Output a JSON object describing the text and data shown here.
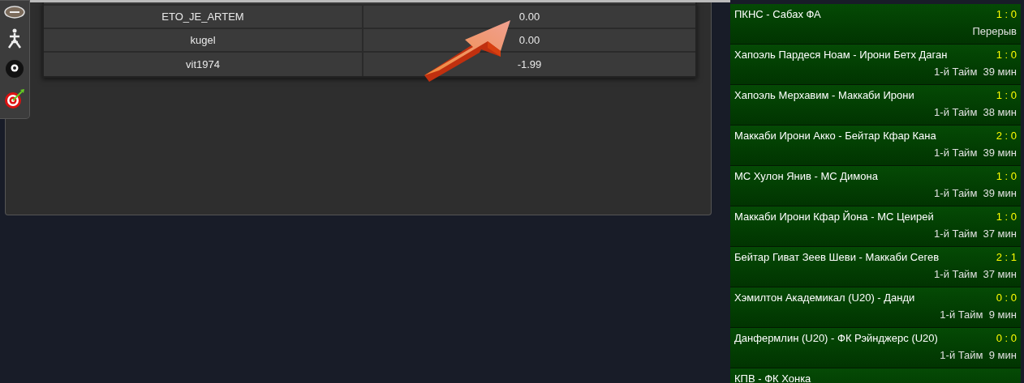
{
  "results_table": {
    "rows": [
      {
        "player": "ETO_JE_ARTEM",
        "amount": "0.00"
      },
      {
        "player": "kugel",
        "amount": "0.00"
      },
      {
        "player": "vit1974",
        "amount": "-1.99"
      }
    ]
  },
  "live_matches": [
    {
      "teams": "ПКНС - Сабах ФА",
      "score": "1 : 0",
      "status": "Перерыв"
    },
    {
      "teams": "Хапоэль Пардеся Ноам - Ирони Бетх Даган",
      "score": "1 : 0",
      "status": "1-й Тайм  39 мин"
    },
    {
      "teams": "Хапоэль Мерхавим - Маккаби Ирони",
      "score": "1 : 0",
      "status": "1-й Тайм  38 мин"
    },
    {
      "teams": "Маккаби Ирони Акко - Бейтар Кфар Кана",
      "score": "2 : 0",
      "status": "1-й Тайм  39 мин"
    },
    {
      "teams": "МС Хулон Янив - МС Димона",
      "score": "1 : 0",
      "status": "1-й Тайм  39 мин"
    },
    {
      "teams": "Маккаби Ирони Кфар Йона - МС Цеирей",
      "score": "1 : 0",
      "status": "1-й Тайм  37 мин"
    },
    {
      "teams": "Бейтар Гиват Зеев Шеви - Маккаби Сегев",
      "score": "2 : 1",
      "status": "1-й Тайм  37 мин"
    },
    {
      "teams": "Хэмилтон Академикал (U20) - Данди",
      "score": "0 : 0",
      "status": "1-й Тайм  9 мин"
    },
    {
      "teams": "Данфермлин (U20) - ФК Рэйнджерс (U20)",
      "score": "0 : 0",
      "status": "1-й Тайм  9 мин"
    },
    {
      "teams": "КПВ - ФК Хонка"
    }
  ]
}
